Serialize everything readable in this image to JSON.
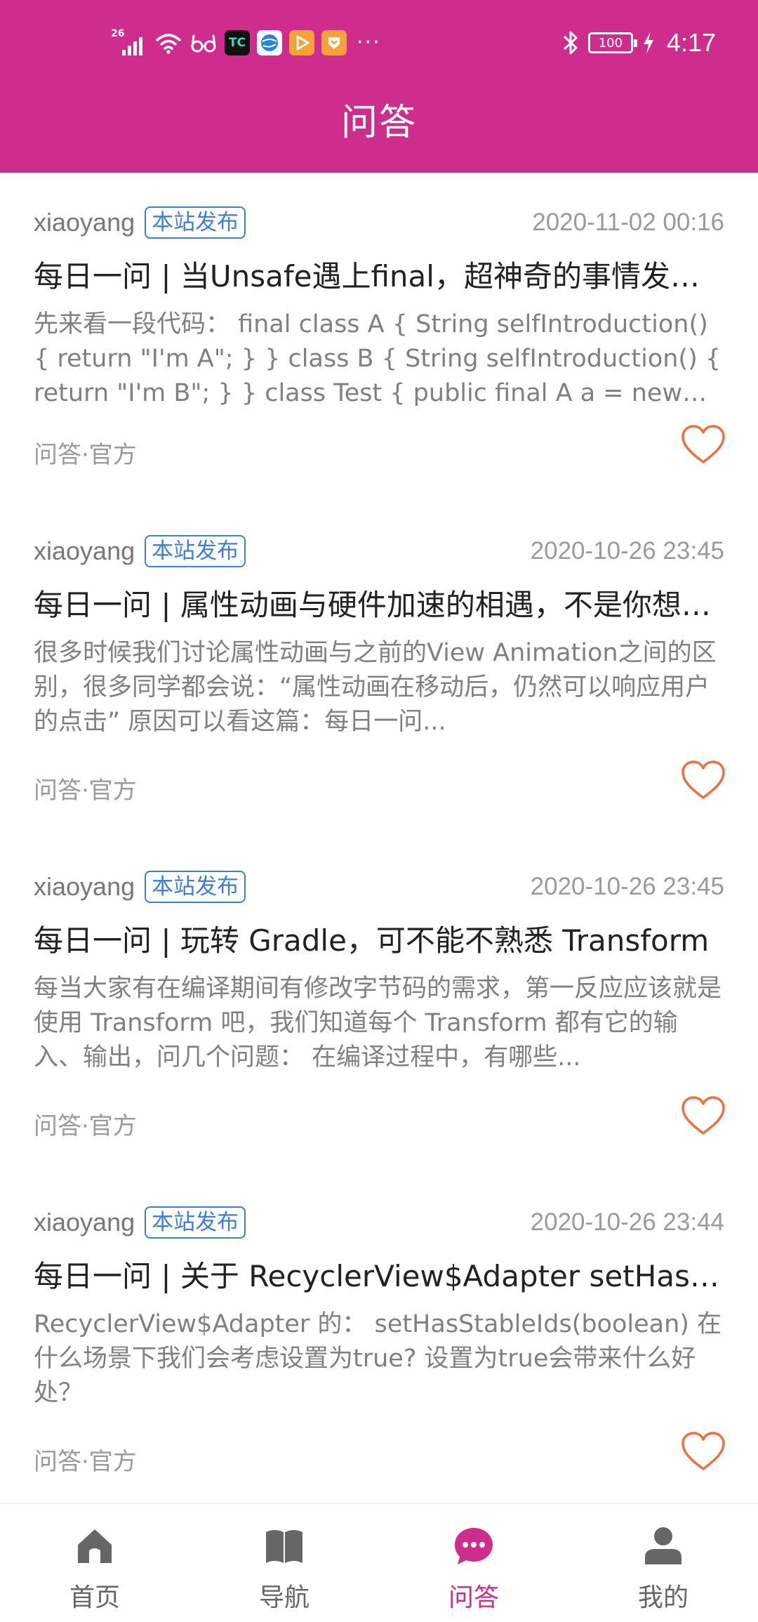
{
  "colors": {
    "header_bg": "#cf2d8e",
    "accent": "#cf2d8e",
    "tag": "#3d7fd6",
    "heart": "#e8733f",
    "nav_inactive": "#666666"
  },
  "status_bar": {
    "network": "26",
    "battery": "100",
    "time": "4:17",
    "more": "···",
    "icons": [
      "signal-icon",
      "wifi-icon",
      "glasses-icon",
      "app-tc-icon",
      "app-globe-icon",
      "app-play-icon",
      "app-heart-icon",
      "bluetooth-icon",
      "battery-icon",
      "charging-icon"
    ]
  },
  "header": {
    "title": "问答"
  },
  "articles": [
    {
      "author": "xiaoyang",
      "tag": "本站发布",
      "date": "2020-11-02 00:16",
      "title": "每日一问 | 当Unsafe遇上final，超神奇的事情发生了",
      "desc": "先来看一段代码： final class A { String selfIntroduction() { return \"I'm A\"; } } class B { String selfIntroduction() { return \"I'm B\"; } } class Test { public final A a = new A();...",
      "chapter": "问答·官方",
      "liked": false
    },
    {
      "author": "xiaoyang",
      "tag": "本站发布",
      "date": "2020-10-26 23:45",
      "title": "每日一问 | 属性动画与硬件加速的相遇，不是你想的那样",
      "desc": "很多时候我们讨论属性动画与之前的View Animation之间的区别，很多同学都会说：“属性动画在移动后，仍然可以响应用户的点击” 原因可以看这篇：每日一问...",
      "chapter": "问答·官方",
      "liked": false
    },
    {
      "author": "xiaoyang",
      "tag": "本站发布",
      "date": "2020-10-26 23:45",
      "title": "每日一问 | 玩转 Gradle，可不能不熟悉 Transform",
      "desc": "每当大家有在编译期间有修改字节码的需求，第一反应应该就是使用 Transform 吧，我们知道每个 Transform 都有它的输入、输出，问几个问题： 在编译过程中，有哪些...",
      "chapter": "问答·官方",
      "liked": false
    },
    {
      "author": "xiaoyang",
      "tag": "本站发布",
      "date": "2020-10-26 23:44",
      "title": "每日一问 | 关于 RecyclerView$Adapter setHasStableIds",
      "desc": "RecyclerView$Adapter 的： setHasStableIds(boolean) 在什么场景下我们会考虑设置为true? 设置为true会带来什么好处？",
      "chapter": "问答·官方",
      "liked": false
    }
  ],
  "bottom_nav": {
    "active": 2,
    "items": [
      {
        "label": "首页",
        "icon": "home-icon"
      },
      {
        "label": "导航",
        "icon": "book-icon"
      },
      {
        "label": "问答",
        "icon": "chat-bubble-icon"
      },
      {
        "label": "我的",
        "icon": "user-icon"
      }
    ]
  }
}
